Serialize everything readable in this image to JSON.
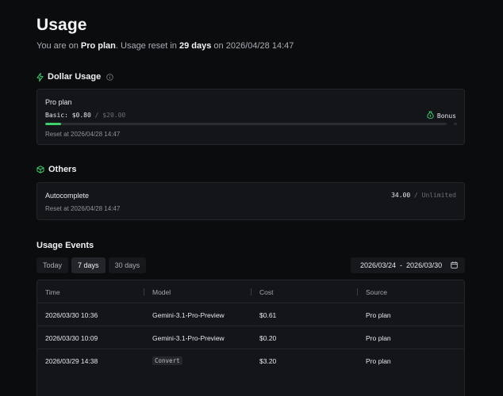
{
  "header": {
    "title": "Usage",
    "subtitle_prefix": "You are on ",
    "plan": "Pro plan",
    "subtitle_mid": ". Usage reset in ",
    "days": "29 days",
    "subtitle_on": " on ",
    "reset_datetime": "2026/04/28 14:47"
  },
  "dollar_usage": {
    "heading": "Dollar Usage",
    "plan_name": "Pro plan",
    "basic_label": "Basic:",
    "used": "$0.80",
    "slash": "/",
    "limit": "$20.00",
    "progress_fraction": 0.04,
    "bonus_label": "Bonus",
    "reset_text": "Reset at 2026/04/28 14:47"
  },
  "others": {
    "heading": "Others",
    "autocomplete_label": "Autocomplete",
    "autocomplete_used": "34.00",
    "slash": "/",
    "autocomplete_limit": "Unlimited",
    "reset_text": "Reset at 2026/04/28 14:47"
  },
  "usage_events": {
    "heading": "Usage Events",
    "tabs": [
      "Today",
      "7 days",
      "30 days"
    ],
    "active_tab": "7 days",
    "date_start": "2026/03/24",
    "date_sep": "-",
    "date_end": "2026/03/30",
    "columns": [
      "Time",
      "Model",
      "Cost",
      "Source"
    ],
    "rows": [
      {
        "time": "2026/03/30 10:36",
        "model": "Gemini-3.1-Pro-Preview",
        "cost": "$0.61",
        "source": "Pro plan"
      },
      {
        "time": "2026/03/30 10:09",
        "model": "Gemini-3.1-Pro-Preview",
        "cost": "$0.20",
        "source": "Pro plan"
      },
      {
        "time": "2026/03/29 14:38",
        "model": "Convert",
        "cost": "$3.20",
        "source": "Pro plan"
      }
    ]
  },
  "colors": {
    "accent": "#3ecf6e",
    "background": "#0b0c0e",
    "card": "#141518"
  }
}
